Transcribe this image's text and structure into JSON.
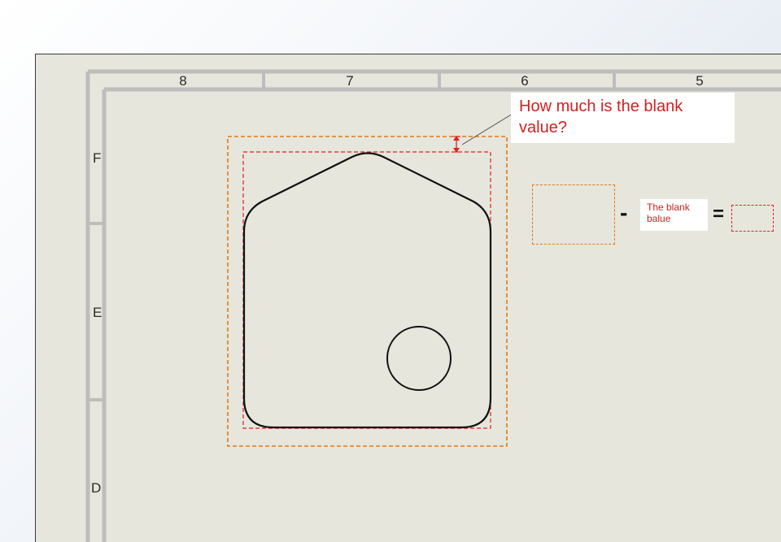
{
  "sheet": {
    "column_labels": [
      "8",
      "7",
      "6",
      "5"
    ],
    "row_labels": [
      "F",
      "E",
      "D"
    ]
  },
  "callout": {
    "question_line1": "How much is the blank",
    "question_line2": "value?"
  },
  "equation": {
    "minus": "-",
    "equals": "=",
    "blank_label_line1": "The blank",
    "blank_label_line2": "balue"
  },
  "colors": {
    "sheet_background": "#e6e6dc",
    "frame_border": "#bfbfbf",
    "outer_boundary": "#e07a1a",
    "inner_boundary": "#e02020",
    "annotation_text": "#d42020",
    "part_outline": "#111111"
  }
}
